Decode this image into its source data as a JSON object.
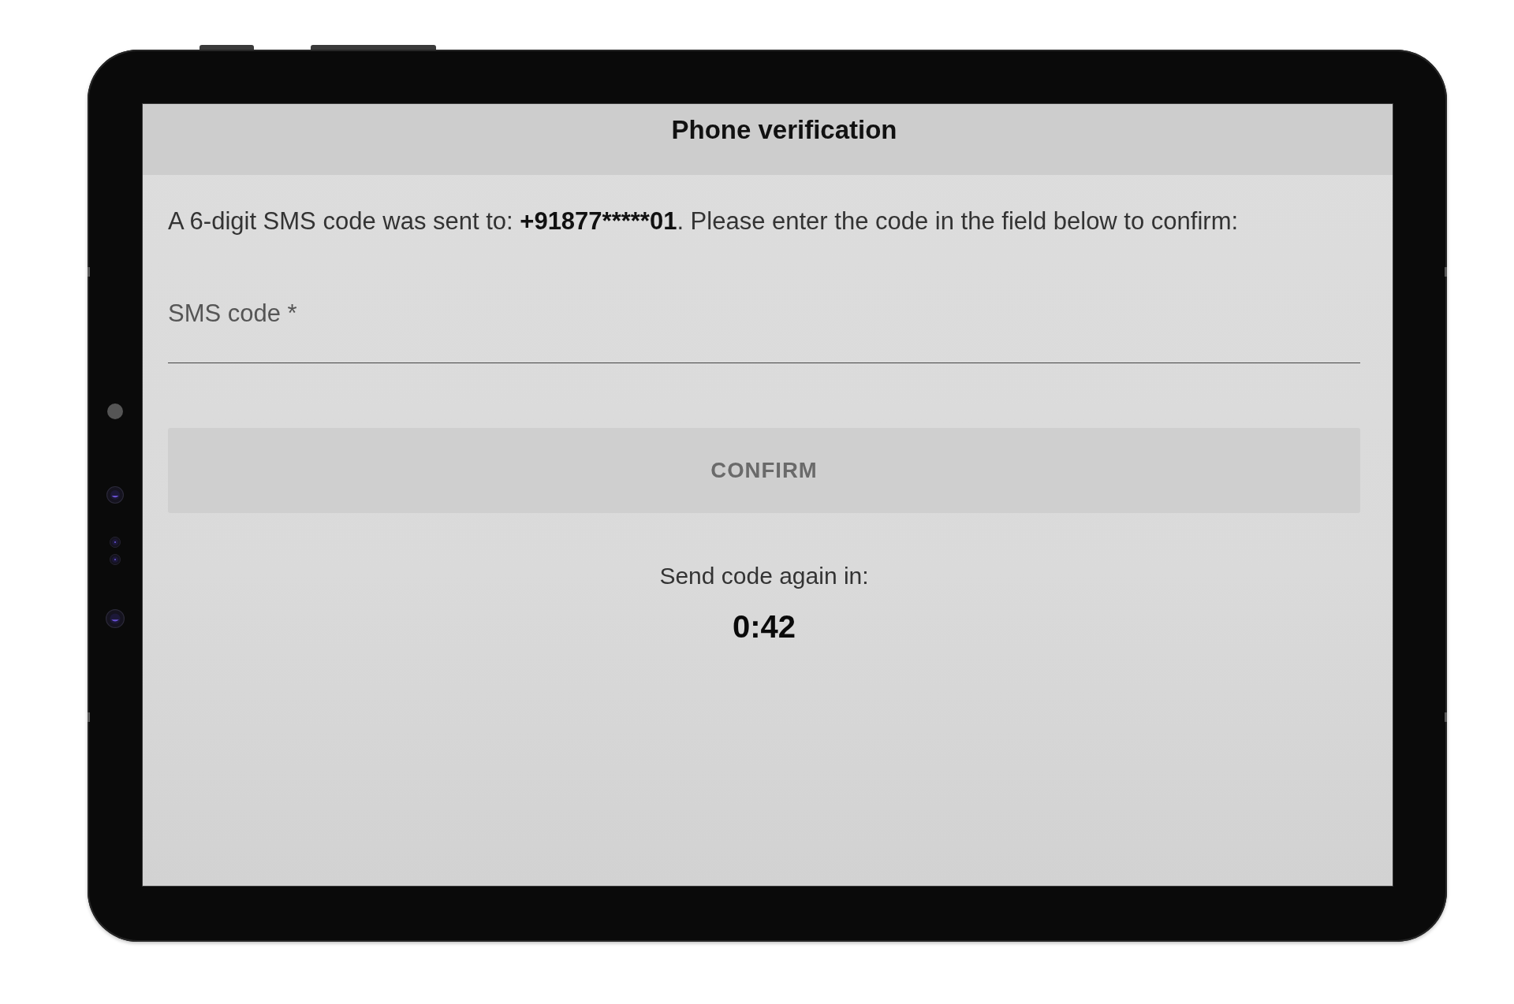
{
  "header": {
    "title": "Phone verification"
  },
  "message": {
    "before": "A 6-digit SMS code was sent to: ",
    "phone": "+91877*****01",
    "after": ". Please enter the code in the field below to confirm:"
  },
  "sms_field": {
    "placeholder": "SMS code *"
  },
  "confirm_button": {
    "label": "CONFIRM",
    "disabled": true
  },
  "resend": {
    "label": "Send code again in:",
    "countdown": "0:42"
  }
}
